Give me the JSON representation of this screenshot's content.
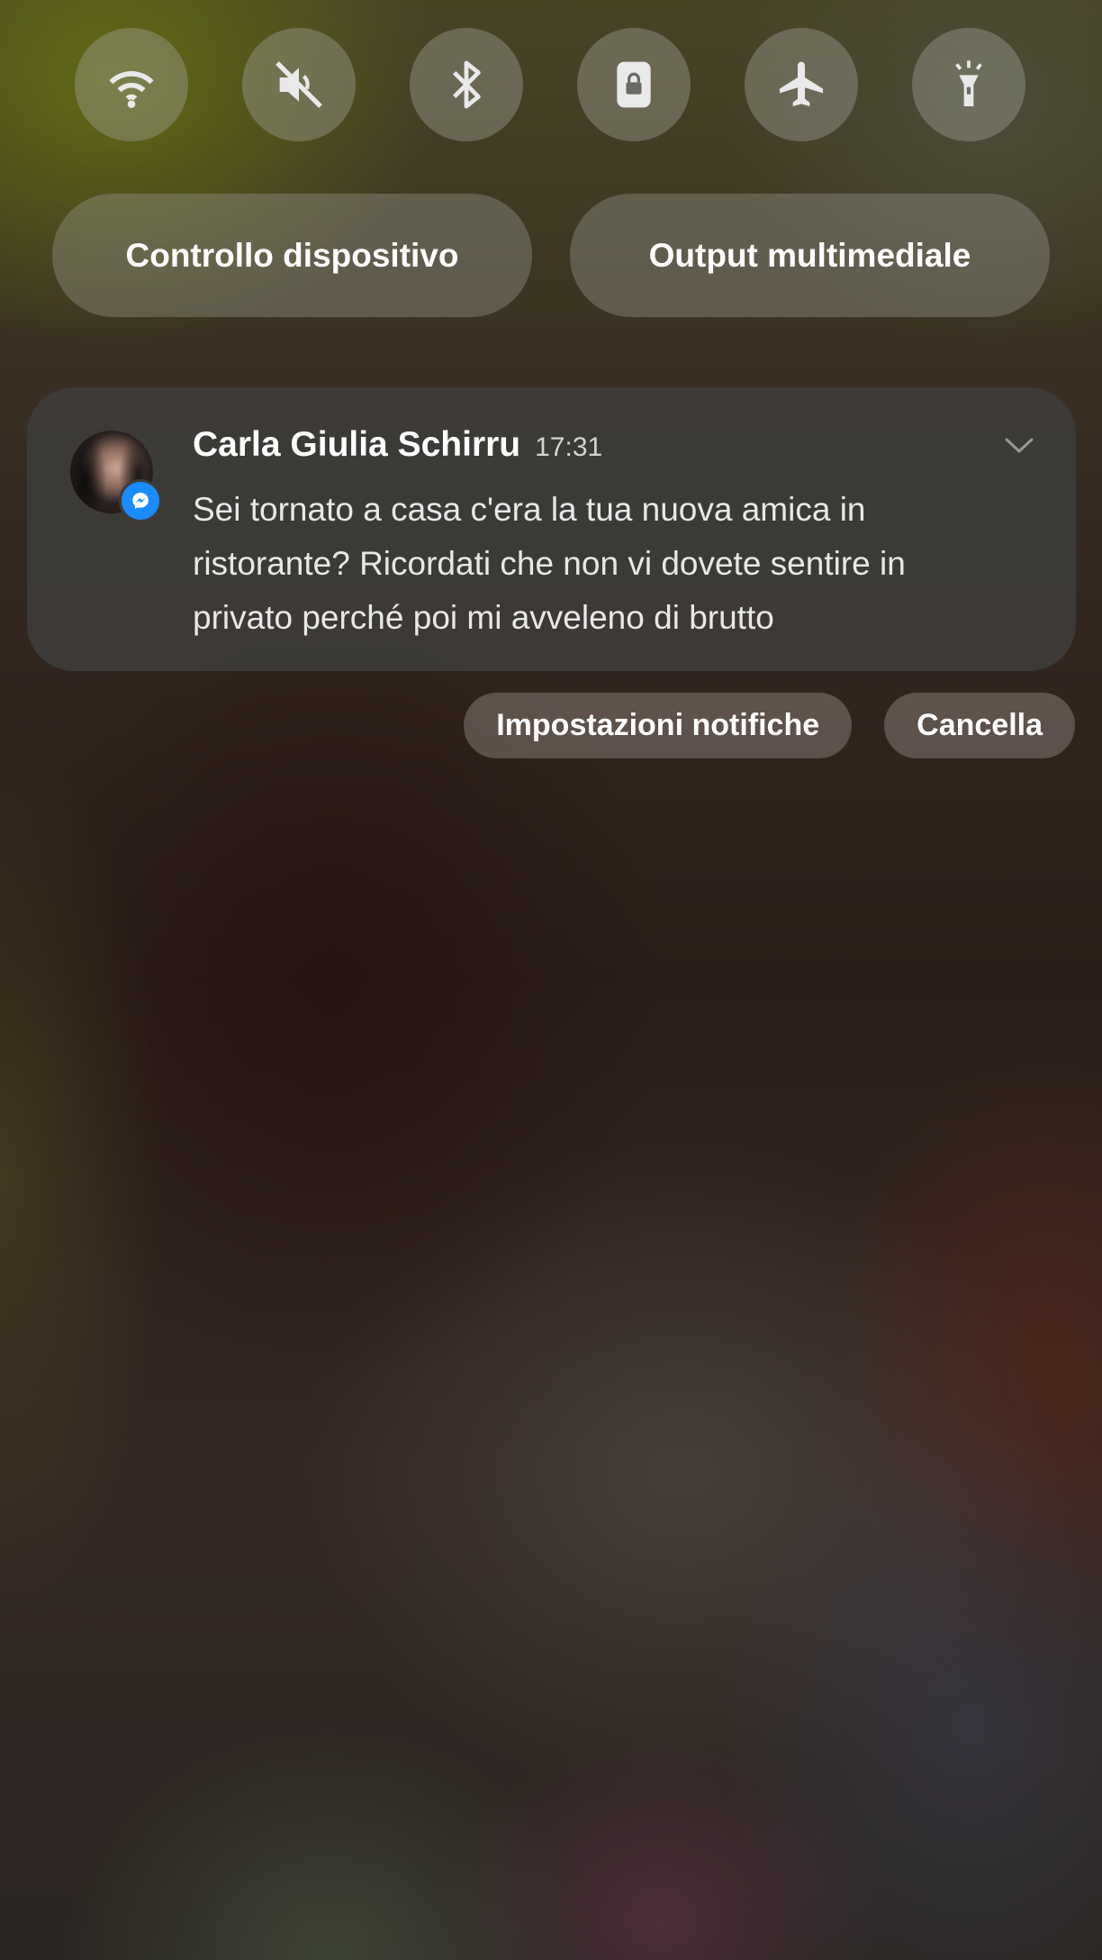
{
  "quick_settings": {
    "toggles": [
      {
        "icon": "wifi-icon"
      },
      {
        "icon": "mute-icon"
      },
      {
        "icon": "bluetooth-icon"
      },
      {
        "icon": "lock-rotation-icon"
      },
      {
        "icon": "airplane-icon"
      },
      {
        "icon": "flashlight-icon"
      }
    ],
    "device_control_label": "Controllo dispositivo",
    "media_output_label": "Output multimediale"
  },
  "notification": {
    "sender": "Carla Giulia Schirru",
    "time": "17:31",
    "app_icon": "messenger-icon",
    "app_color": "#1a8cff",
    "message": "Sei tornato a casa c'era la tua nuova amica in ristorante? Ricordati che non vi dovete sentire in privato perché poi mi avveleno di brutto"
  },
  "actions": {
    "settings_label": "Impostazioni notifiche",
    "clear_label": "Cancella"
  }
}
